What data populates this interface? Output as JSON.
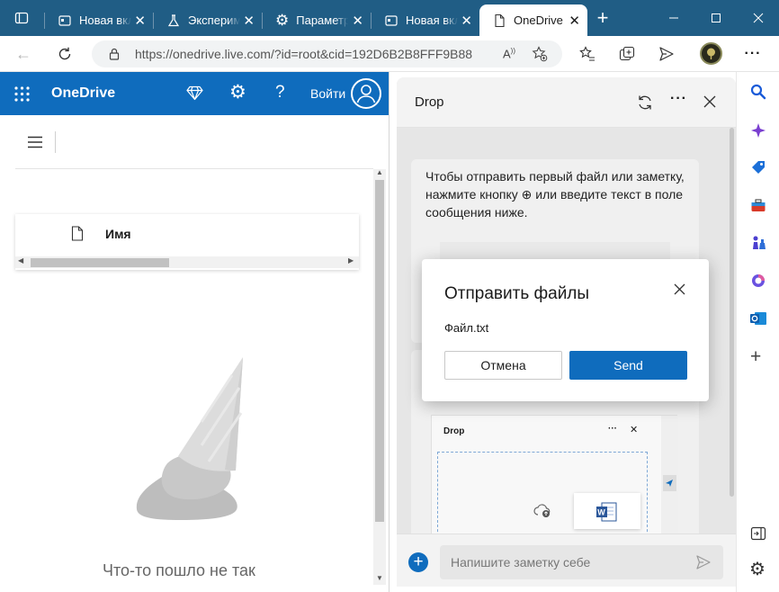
{
  "browser": {
    "tabs": [
      {
        "label": "Новая вкладка",
        "icon": "new-tab-icon"
      },
      {
        "label": "Эксперименты",
        "icon": "flask-icon"
      },
      {
        "label": "Параметры",
        "icon": "gear-icon"
      },
      {
        "label": "Новая вкладка",
        "icon": "new-tab-icon"
      },
      {
        "label": "OneDrive",
        "icon": "page-icon",
        "active": true
      }
    ],
    "url": "https://onedrive.live.com/?id=root&cid=192D6B2B8FFF9B88"
  },
  "onedrive": {
    "app_name": "OneDrive",
    "signin_label": "Войти",
    "column_name": "Имя",
    "error_text": "Что-то пошло не так",
    "brand_color": "#0f6cbd"
  },
  "drop": {
    "title": "Drop",
    "intro": "Чтобы отправить первый файл или заметку, нажмите кнопку ⊕ или введите текст в поле сообщения ниже.",
    "preview_title": "Drop",
    "input_placeholder": "Напишите заметку себе"
  },
  "dialog": {
    "title": "Отправить файлы",
    "file_name": "Файл.txt",
    "cancel_label": "Отмена",
    "send_label": "Send",
    "accent_color": "#0f6cbd"
  }
}
